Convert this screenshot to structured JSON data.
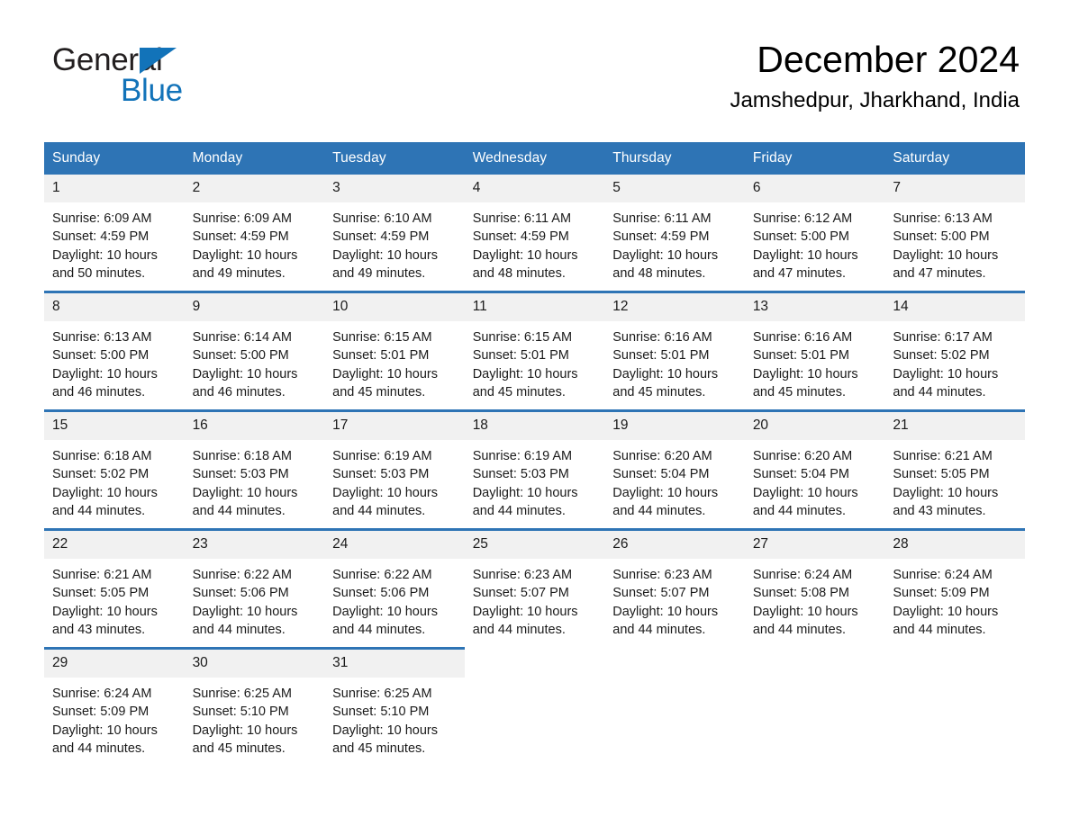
{
  "brand": {
    "name_part1": "General",
    "name_part2": "Blue",
    "triangle_color": "#1273b9",
    "text_color": "#231f20"
  },
  "header": {
    "title": "December 2024",
    "location": "Jamshedpur, Jharkhand, India"
  },
  "colors": {
    "header_blue": "#2e74b5",
    "day_band_gray": "#f1f1f1",
    "page_background": "#ffffff",
    "text": "#1a1a1a"
  },
  "weekday_headers": [
    "Sunday",
    "Monday",
    "Tuesday",
    "Wednesday",
    "Thursday",
    "Friday",
    "Saturday"
  ],
  "weeks": [
    {
      "days": [
        {
          "num": "1",
          "sunrise": "Sunrise: 6:09 AM",
          "sunset": "Sunset: 4:59 PM",
          "daylight_line1": "Daylight: 10 hours",
          "daylight_line2": "and 50 minutes."
        },
        {
          "num": "2",
          "sunrise": "Sunrise: 6:09 AM",
          "sunset": "Sunset: 4:59 PM",
          "daylight_line1": "Daylight: 10 hours",
          "daylight_line2": "and 49 minutes."
        },
        {
          "num": "3",
          "sunrise": "Sunrise: 6:10 AM",
          "sunset": "Sunset: 4:59 PM",
          "daylight_line1": "Daylight: 10 hours",
          "daylight_line2": "and 49 minutes."
        },
        {
          "num": "4",
          "sunrise": "Sunrise: 6:11 AM",
          "sunset": "Sunset: 4:59 PM",
          "daylight_line1": "Daylight: 10 hours",
          "daylight_line2": "and 48 minutes."
        },
        {
          "num": "5",
          "sunrise": "Sunrise: 6:11 AM",
          "sunset": "Sunset: 4:59 PM",
          "daylight_line1": "Daylight: 10 hours",
          "daylight_line2": "and 48 minutes."
        },
        {
          "num": "6",
          "sunrise": "Sunrise: 6:12 AM",
          "sunset": "Sunset: 5:00 PM",
          "daylight_line1": "Daylight: 10 hours",
          "daylight_line2": "and 47 minutes."
        },
        {
          "num": "7",
          "sunrise": "Sunrise: 6:13 AM",
          "sunset": "Sunset: 5:00 PM",
          "daylight_line1": "Daylight: 10 hours",
          "daylight_line2": "and 47 minutes."
        }
      ]
    },
    {
      "days": [
        {
          "num": "8",
          "sunrise": "Sunrise: 6:13 AM",
          "sunset": "Sunset: 5:00 PM",
          "daylight_line1": "Daylight: 10 hours",
          "daylight_line2": "and 46 minutes."
        },
        {
          "num": "9",
          "sunrise": "Sunrise: 6:14 AM",
          "sunset": "Sunset: 5:00 PM",
          "daylight_line1": "Daylight: 10 hours",
          "daylight_line2": "and 46 minutes."
        },
        {
          "num": "10",
          "sunrise": "Sunrise: 6:15 AM",
          "sunset": "Sunset: 5:01 PM",
          "daylight_line1": "Daylight: 10 hours",
          "daylight_line2": "and 45 minutes."
        },
        {
          "num": "11",
          "sunrise": "Sunrise: 6:15 AM",
          "sunset": "Sunset: 5:01 PM",
          "daylight_line1": "Daylight: 10 hours",
          "daylight_line2": "and 45 minutes."
        },
        {
          "num": "12",
          "sunrise": "Sunrise: 6:16 AM",
          "sunset": "Sunset: 5:01 PM",
          "daylight_line1": "Daylight: 10 hours",
          "daylight_line2": "and 45 minutes."
        },
        {
          "num": "13",
          "sunrise": "Sunrise: 6:16 AM",
          "sunset": "Sunset: 5:01 PM",
          "daylight_line1": "Daylight: 10 hours",
          "daylight_line2": "and 45 minutes."
        },
        {
          "num": "14",
          "sunrise": "Sunrise: 6:17 AM",
          "sunset": "Sunset: 5:02 PM",
          "daylight_line1": "Daylight: 10 hours",
          "daylight_line2": "and 44 minutes."
        }
      ]
    },
    {
      "days": [
        {
          "num": "15",
          "sunrise": "Sunrise: 6:18 AM",
          "sunset": "Sunset: 5:02 PM",
          "daylight_line1": "Daylight: 10 hours",
          "daylight_line2": "and 44 minutes."
        },
        {
          "num": "16",
          "sunrise": "Sunrise: 6:18 AM",
          "sunset": "Sunset: 5:03 PM",
          "daylight_line1": "Daylight: 10 hours",
          "daylight_line2": "and 44 minutes."
        },
        {
          "num": "17",
          "sunrise": "Sunrise: 6:19 AM",
          "sunset": "Sunset: 5:03 PM",
          "daylight_line1": "Daylight: 10 hours",
          "daylight_line2": "and 44 minutes."
        },
        {
          "num": "18",
          "sunrise": "Sunrise: 6:19 AM",
          "sunset": "Sunset: 5:03 PM",
          "daylight_line1": "Daylight: 10 hours",
          "daylight_line2": "and 44 minutes."
        },
        {
          "num": "19",
          "sunrise": "Sunrise: 6:20 AM",
          "sunset": "Sunset: 5:04 PM",
          "daylight_line1": "Daylight: 10 hours",
          "daylight_line2": "and 44 minutes."
        },
        {
          "num": "20",
          "sunrise": "Sunrise: 6:20 AM",
          "sunset": "Sunset: 5:04 PM",
          "daylight_line1": "Daylight: 10 hours",
          "daylight_line2": "and 44 minutes."
        },
        {
          "num": "21",
          "sunrise": "Sunrise: 6:21 AM",
          "sunset": "Sunset: 5:05 PM",
          "daylight_line1": "Daylight: 10 hours",
          "daylight_line2": "and 43 minutes."
        }
      ]
    },
    {
      "days": [
        {
          "num": "22",
          "sunrise": "Sunrise: 6:21 AM",
          "sunset": "Sunset: 5:05 PM",
          "daylight_line1": "Daylight: 10 hours",
          "daylight_line2": "and 43 minutes."
        },
        {
          "num": "23",
          "sunrise": "Sunrise: 6:22 AM",
          "sunset": "Sunset: 5:06 PM",
          "daylight_line1": "Daylight: 10 hours",
          "daylight_line2": "and 44 minutes."
        },
        {
          "num": "24",
          "sunrise": "Sunrise: 6:22 AM",
          "sunset": "Sunset: 5:06 PM",
          "daylight_line1": "Daylight: 10 hours",
          "daylight_line2": "and 44 minutes."
        },
        {
          "num": "25",
          "sunrise": "Sunrise: 6:23 AM",
          "sunset": "Sunset: 5:07 PM",
          "daylight_line1": "Daylight: 10 hours",
          "daylight_line2": "and 44 minutes."
        },
        {
          "num": "26",
          "sunrise": "Sunrise: 6:23 AM",
          "sunset": "Sunset: 5:07 PM",
          "daylight_line1": "Daylight: 10 hours",
          "daylight_line2": "and 44 minutes."
        },
        {
          "num": "27",
          "sunrise": "Sunrise: 6:24 AM",
          "sunset": "Sunset: 5:08 PM",
          "daylight_line1": "Daylight: 10 hours",
          "daylight_line2": "and 44 minutes."
        },
        {
          "num": "28",
          "sunrise": "Sunrise: 6:24 AM",
          "sunset": "Sunset: 5:09 PM",
          "daylight_line1": "Daylight: 10 hours",
          "daylight_line2": "and 44 minutes."
        }
      ]
    },
    {
      "days": [
        {
          "num": "29",
          "sunrise": "Sunrise: 6:24 AM",
          "sunset": "Sunset: 5:09 PM",
          "daylight_line1": "Daylight: 10 hours",
          "daylight_line2": "and 44 minutes."
        },
        {
          "num": "30",
          "sunrise": "Sunrise: 6:25 AM",
          "sunset": "Sunset: 5:10 PM",
          "daylight_line1": "Daylight: 10 hours",
          "daylight_line2": "and 45 minutes."
        },
        {
          "num": "31",
          "sunrise": "Sunrise: 6:25 AM",
          "sunset": "Sunset: 5:10 PM",
          "daylight_line1": "Daylight: 10 hours",
          "daylight_line2": "and 45 minutes."
        },
        {
          "num": "",
          "sunrise": "",
          "sunset": "",
          "daylight_line1": "",
          "daylight_line2": "",
          "empty": true
        },
        {
          "num": "",
          "sunrise": "",
          "sunset": "",
          "daylight_line1": "",
          "daylight_line2": "",
          "empty": true
        },
        {
          "num": "",
          "sunrise": "",
          "sunset": "",
          "daylight_line1": "",
          "daylight_line2": "",
          "empty": true
        },
        {
          "num": "",
          "sunrise": "",
          "sunset": "",
          "daylight_line1": "",
          "daylight_line2": "",
          "empty": true
        }
      ]
    }
  ]
}
